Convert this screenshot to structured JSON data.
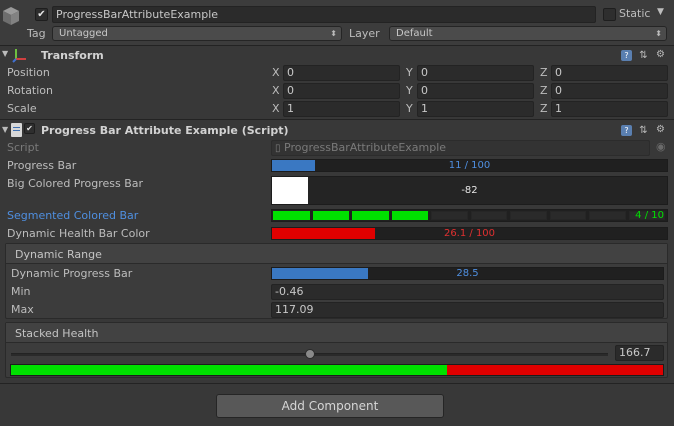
{
  "gameobject": {
    "name": "ProgressBarAttributeExample",
    "static_label": "Static",
    "tag_label": "Tag",
    "tag_value": "Untagged",
    "layer_label": "Layer",
    "layer_value": "Default"
  },
  "transform": {
    "title": "Transform",
    "rows": [
      {
        "label": "Position",
        "x": "0",
        "y": "0",
        "z": "0"
      },
      {
        "label": "Rotation",
        "x": "0",
        "y": "0",
        "z": "0"
      },
      {
        "label": "Scale",
        "x": "1",
        "y": "1",
        "z": "1"
      }
    ],
    "axis": {
      "x": "X",
      "y": "Y",
      "z": "Z"
    }
  },
  "script_component": {
    "title": "Progress Bar Attribute Example (Script)",
    "script_label": "Script",
    "script_value": "ProgressBarAttributeExample",
    "progress_bar": {
      "label": "Progress Bar",
      "text": "11 / 100",
      "fraction": 0.11,
      "color": "#3a78c2"
    },
    "big_bar": {
      "label": "Big Colored Progress Bar",
      "text": "-82",
      "fill_color": "#ffffff"
    },
    "segmented": {
      "label": "Segmented Colored Bar",
      "text": "4 / 10",
      "filled": 4,
      "total": 10,
      "color": "#00e000"
    },
    "health": {
      "label": "Dynamic Health Bar Color",
      "text": "26.1 / 100",
      "fraction": 0.261,
      "color": "#e00000"
    },
    "dynamic_range": {
      "title": "Dynamic Range",
      "bar_label": "Dynamic Progress Bar",
      "bar_text": "28.5",
      "fraction": 0.245,
      "min_label": "Min",
      "min_value": "-0.46",
      "max_label": "Max",
      "max_value": "117.09"
    },
    "stacked": {
      "title": "Stacked Health",
      "slider_value": "166.7",
      "slider_fraction": 0.5,
      "green_fraction": 0.669,
      "green": "#00e000",
      "red": "#e00000"
    }
  },
  "add_component": "Add Component"
}
